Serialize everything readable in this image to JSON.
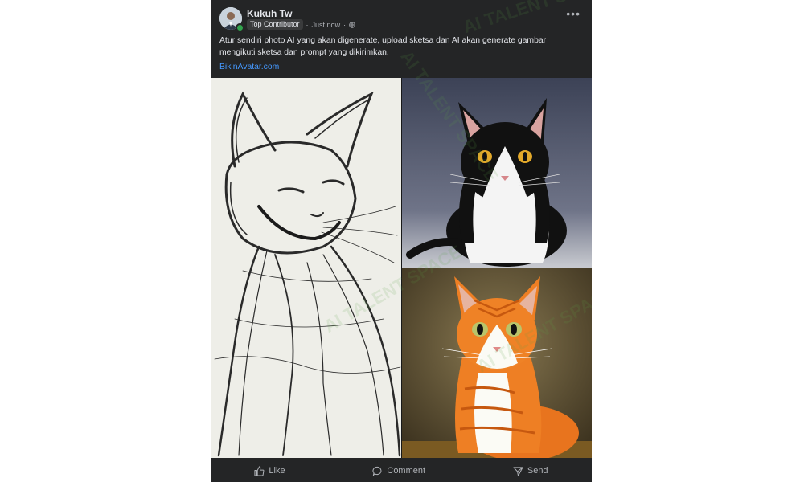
{
  "post": {
    "author": "Kukuh Tw",
    "badge": "Top Contributor",
    "time": "Just now",
    "privacy_icon": "globe-icon",
    "text": "Atur sendiri photo AI yang akan digenerate, upload sketsa dan AI akan generate gambar mengikuti sketsa dan prompt yang dikirimkan.",
    "link": "BikinAvatar.com"
  },
  "images": [
    {
      "name": "pencil sketch cat"
    },
    {
      "name": "black and white cat"
    },
    {
      "name": "orange tabby cat"
    }
  ],
  "watermark": "AI TALENT SPACE",
  "actions": [
    {
      "label": "Like",
      "icon": "like-icon"
    },
    {
      "label": "Comment",
      "icon": "comment-icon"
    },
    {
      "label": "Send",
      "icon": "send-icon"
    }
  ],
  "colors": {
    "card_bg": "#242526",
    "text": "#e4e6eb",
    "muted": "#b0b3b8",
    "link": "#4599ff",
    "online": "#31a24c"
  }
}
